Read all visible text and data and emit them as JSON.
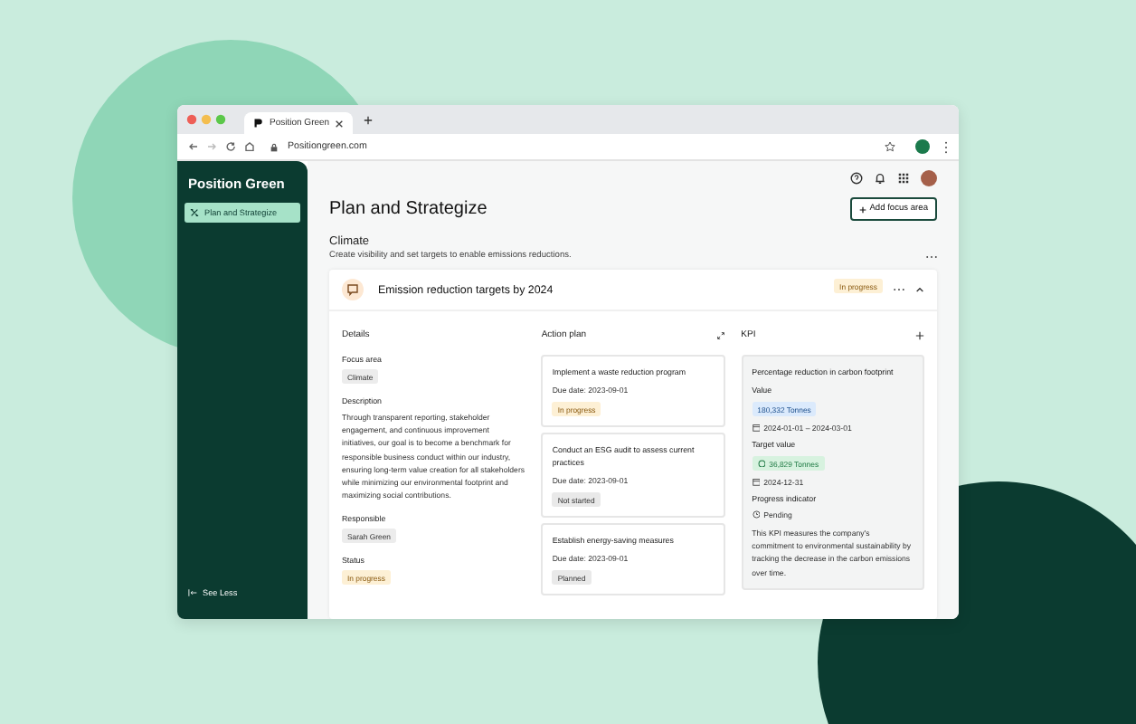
{
  "browser": {
    "tab_title": "Position Green",
    "url": "Positiongreen.com"
  },
  "sidebar": {
    "logo": "Position Green",
    "items": [
      {
        "label": "Plan and Strategize",
        "selected": true
      }
    ],
    "footer": "See Less"
  },
  "page": {
    "title": "Plan and Strategize",
    "add_button": "Add focus area",
    "section_title": "Climate",
    "section_subtitle": "Create visibility and set targets to enable emissions reductions.",
    "card": {
      "title": "Emission reduction targets by 2024",
      "status": "In progress",
      "expanded": true,
      "details": {
        "heading": "Details",
        "fields": [
          {
            "label": "Focus area",
            "kind": "tag",
            "value": "Climate"
          },
          {
            "label": "Description",
            "kind": "text",
            "value": "Through transparent reporting, stakeholder engagement, and continuous improvement initiatives, our goal is to become a benchmark for responsible business conduct within our industry, ensuring long-term value creation for all stakeholders while minimizing our environmental footprint and maximizing social contributions."
          },
          {
            "label": "Responsible",
            "kind": "tag",
            "value": "Sarah Green"
          },
          {
            "label": "Status",
            "kind": "status",
            "value": "In progress"
          }
        ]
      },
      "action_plan": {
        "heading": "Action plan",
        "items": [
          {
            "title": "Implement a waste reduction program",
            "due": "Due date: 2023-09-01",
            "status": "In progress",
            "kind": "progress"
          },
          {
            "title": "Conduct an ESG audit to assess current practices",
            "due": "Due date: 2023-09-01",
            "status": "Not started",
            "kind": "idle"
          },
          {
            "title": "Establish energy-saving measures",
            "due": "Due date: 2023-09-01",
            "status": "Planned",
            "kind": "idle"
          }
        ]
      },
      "kpi": {
        "heading": "KPI",
        "title": "Percentage reduction in carbon footprint",
        "value_label": "Value",
        "value": "180,332 Tonnes",
        "value_dates": "2024-01-01 – 2024-03-01",
        "target_label": "Target value",
        "target": "36,829 Tonnes",
        "target_date": "2024-12-31",
        "progress_label": "Progress indicator",
        "progress": "Pending",
        "description": "This KPI measures the company's commitment to environmental sustainability by tracking the decrease in the carbon emissions over time."
      }
    }
  }
}
